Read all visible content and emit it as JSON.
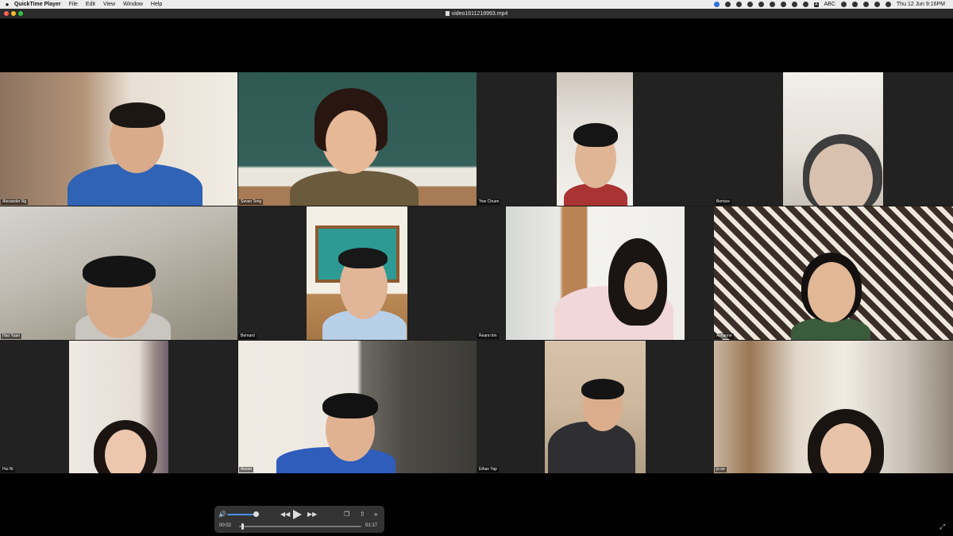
{
  "menubar": {
    "apple_icon": "apple-logo-icon",
    "app_name": "QuickTime Player",
    "menus": [
      "File",
      "Edit",
      "View",
      "Window",
      "Help"
    ],
    "abc_label": "ABC",
    "datetime": "Thu 12 Jun  9:16PM"
  },
  "window": {
    "title": "video1611218993.mp4"
  },
  "participants": [
    {
      "name": "Alexander Ng"
    },
    {
      "name": "Seven Teng"
    },
    {
      "name": "Yew Chuen"
    },
    {
      "name": "Bernice"
    },
    {
      "name": "Hao Yuan"
    },
    {
      "name": "Bernard"
    },
    {
      "name": "Reann lim"
    },
    {
      "name": "Ayrianne"
    },
    {
      "name": "Hui Ni"
    },
    {
      "name": "Anson"
    },
    {
      "name": "Ethan Yap"
    },
    {
      "name": "jo ee"
    }
  ],
  "player": {
    "current_time": "00:02",
    "duration": "01:17",
    "volume_level": 0.85,
    "progress": 0.026,
    "icons": [
      "volume-icon",
      "rewind-icon",
      "play-icon",
      "fast-forward-icon",
      "airplay-icon",
      "share-icon",
      "more-icon",
      "fullscreen-icon"
    ]
  },
  "colors": {
    "accent": "#4a8ee8",
    "close": "#ff5f57",
    "minimize": "#febc2e",
    "maximize": "#28c840"
  }
}
